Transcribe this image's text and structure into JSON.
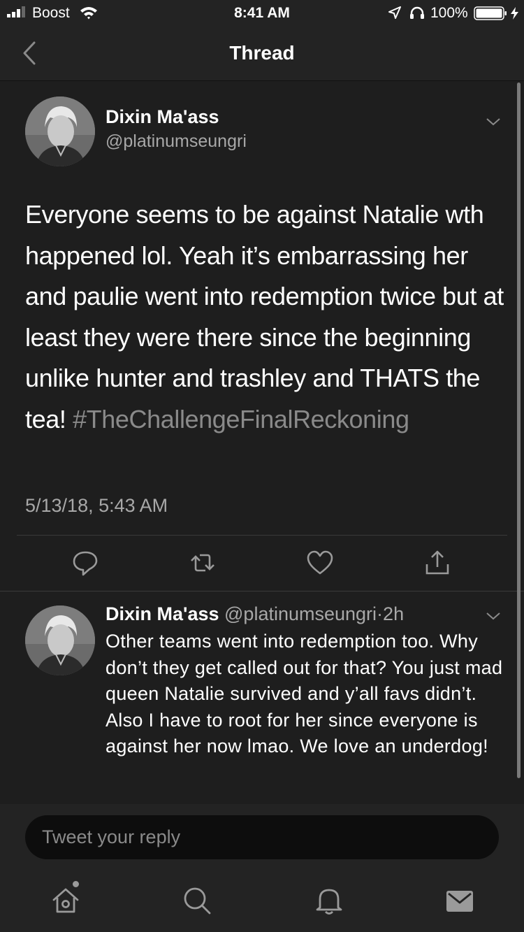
{
  "status_bar": {
    "carrier": "Boost",
    "time": "8:41 AM",
    "battery_percent": "100%",
    "icons": [
      "signal-icon",
      "wifi-icon",
      "location-icon",
      "headphones-icon",
      "battery-icon",
      "charging-bolt-icon"
    ]
  },
  "nav": {
    "title": "Thread",
    "back_icon": "chevron-left-icon"
  },
  "main_tweet": {
    "author_name": "Dixin Ma'ass",
    "author_handle": "@platinumseungri",
    "text": "Everyone seems to be against Natalie wth happened lol. Yeah it’s embarrassing her and paulie went into redemption twice but at least they were there since the beginning unlike hunter and trashley and THATS the tea!",
    "hashtag": "#TheChallengeFinalReckoning",
    "timestamp": "5/13/18, 5:43 AM",
    "actions": [
      "reply-icon",
      "retweet-icon",
      "like-icon",
      "share-icon"
    ]
  },
  "reply_tweet": {
    "author_name": "Dixin Ma'ass",
    "author_handle": "@platinumseungri",
    "separator": "·",
    "age": "2h",
    "text": "Other teams went into redemption too. Why don’t they get called out for that? You just mad queen Natalie survived and y’all favs didn’t. Also I have to root for her since everyone is against her now lmao. We love an underdog!"
  },
  "reply_composer": {
    "placeholder": "Tweet your reply"
  },
  "tab_bar": {
    "items": [
      "home-icon",
      "search-icon",
      "notifications-icon",
      "messages-icon"
    ],
    "home_has_new_dot": true
  },
  "colors": {
    "background": "#1e1e1e",
    "bar_background": "#232323",
    "text_primary": "#ffffff",
    "text_secondary": "#a8a8a8",
    "hashtag": "#8a8a8a"
  }
}
